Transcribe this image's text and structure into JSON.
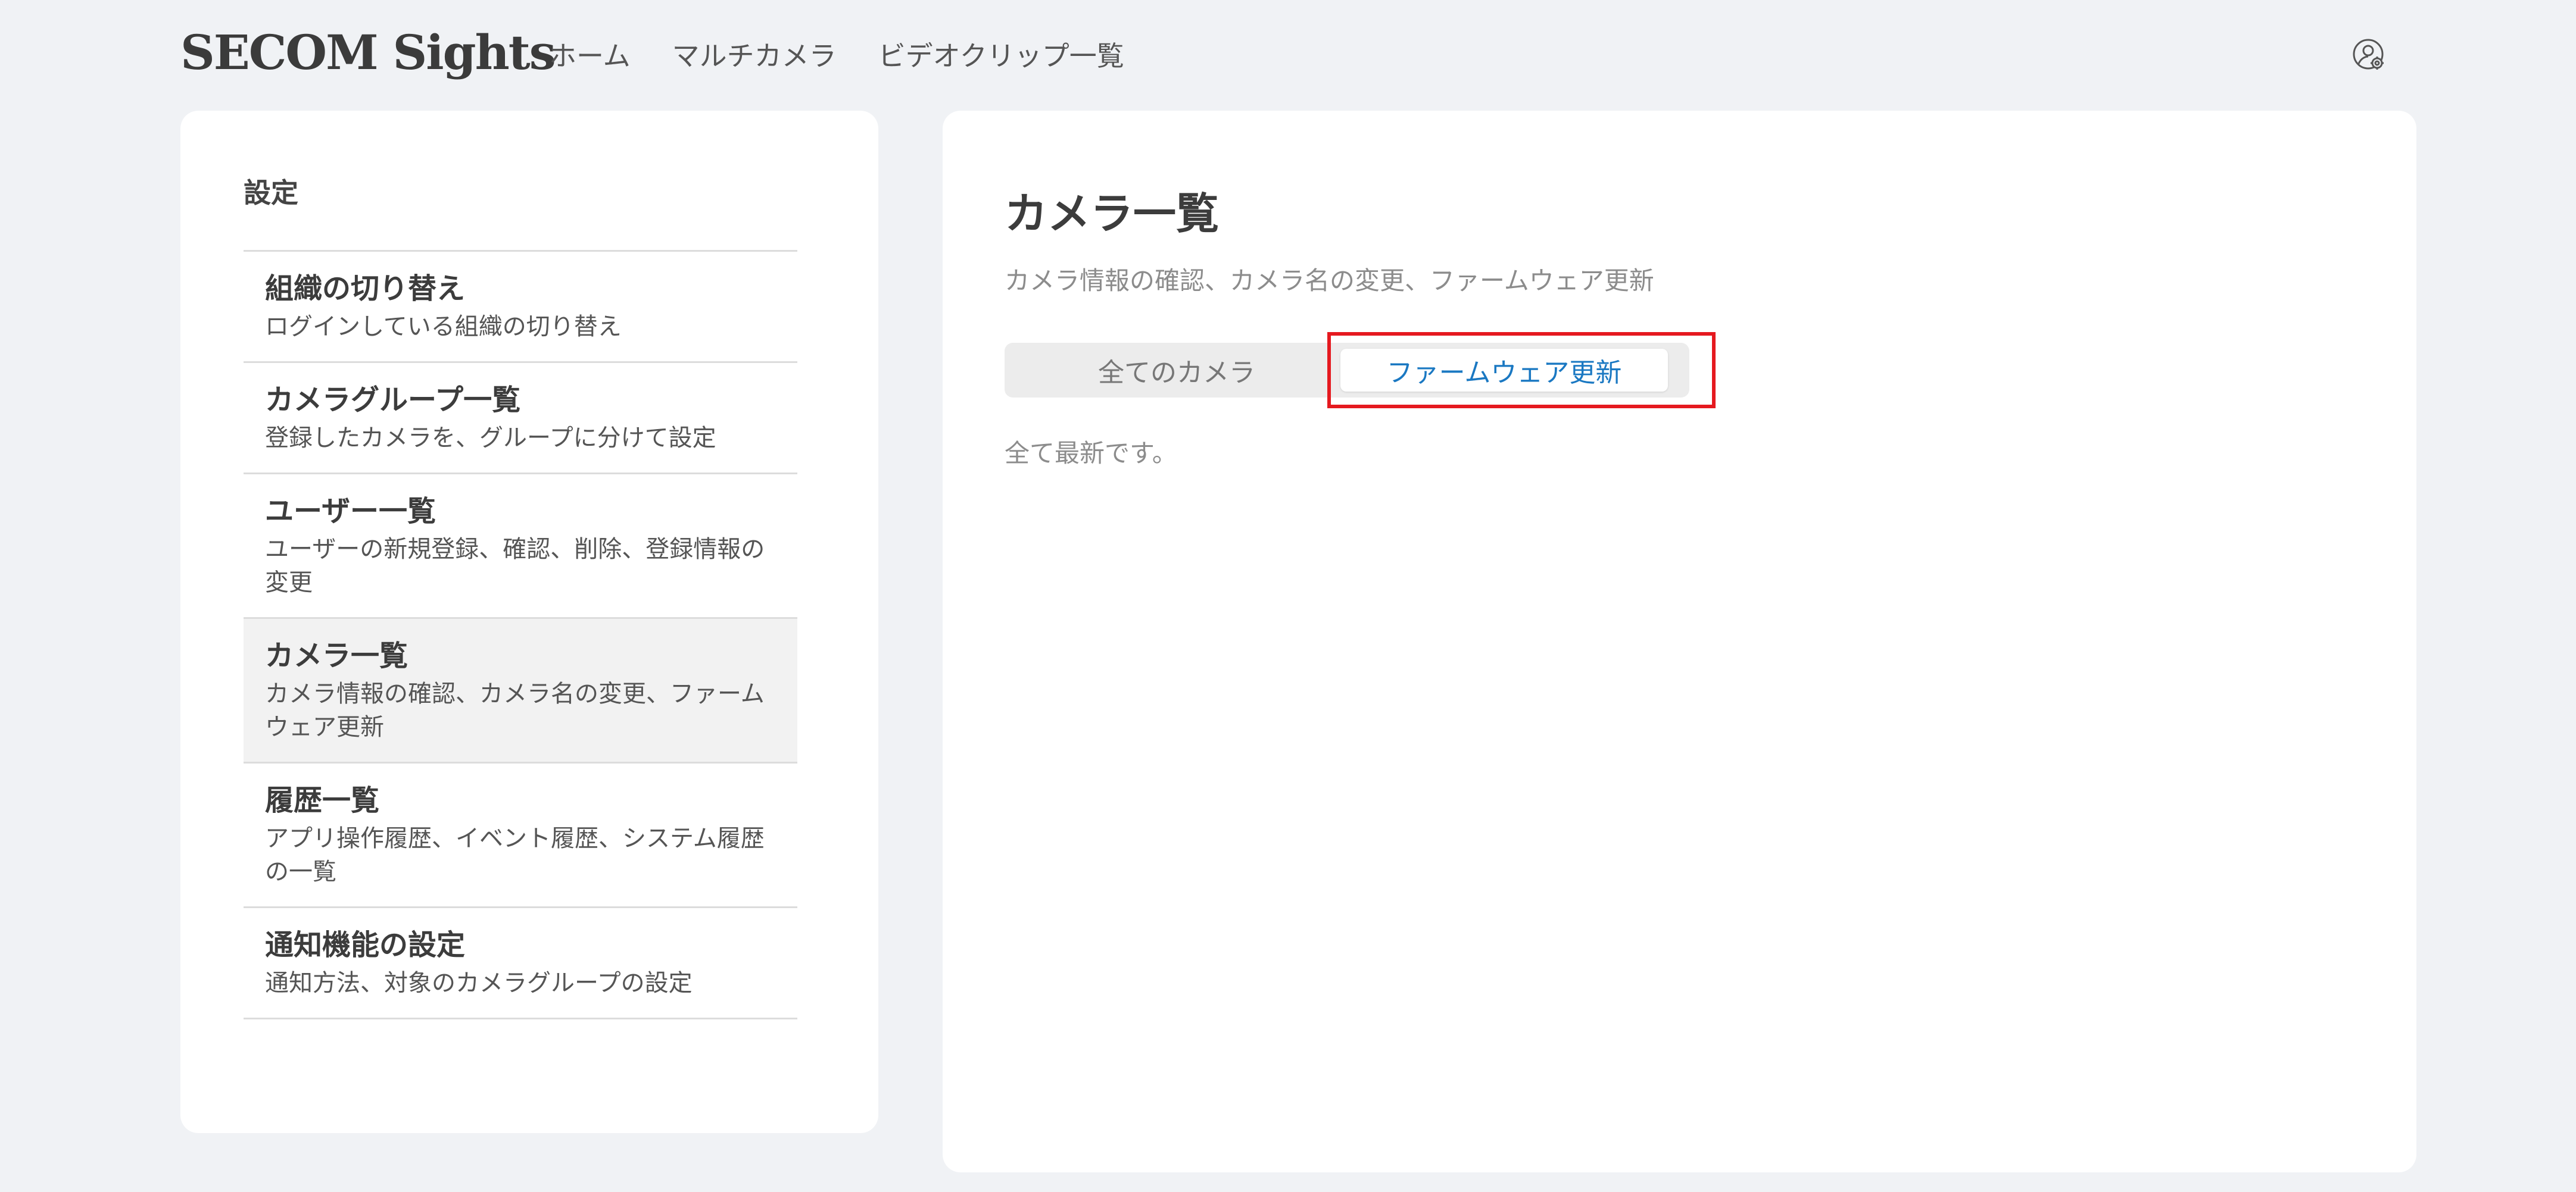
{
  "header": {
    "logo": "SECOM Sights",
    "nav": [
      {
        "label": "ホーム"
      },
      {
        "label": "マルチカメラ"
      },
      {
        "label": "ビデオクリップ一覧"
      }
    ],
    "account_icon": "account-settings-icon"
  },
  "sidebar": {
    "title": "設定",
    "items": [
      {
        "title": "組織の切り替え",
        "description": "ログインしている組織の切り替え",
        "active": false
      },
      {
        "title": "カメラグループ一覧",
        "description": "登録したカメラを、グループに分けて設定",
        "active": false
      },
      {
        "title": "ユーザー一覧",
        "description": "ユーザーの新規登録、確認、削除、登録情報の変更",
        "active": false
      },
      {
        "title": "カメラ一覧",
        "description": "カメラ情報の確認、カメラ名の変更、ファームウェア更新",
        "active": true
      },
      {
        "title": "履歴一覧",
        "description": "アプリ操作履歴、イベント履歴、システム履歴の一覧",
        "active": false
      },
      {
        "title": "通知機能の設定",
        "description": "通知方法、対象のカメラグループの設定",
        "active": false
      }
    ]
  },
  "main": {
    "title": "カメラ一覧",
    "description": "カメラ情報の確認、カメラ名の変更、ファームウェア更新",
    "tabs": [
      {
        "label": "全てのカメラ",
        "selected": false
      },
      {
        "label": "ファームウェア更新",
        "selected": true
      }
    ],
    "status": "全て最新です。"
  },
  "colors": {
    "background": "#f0f2f5",
    "accent": "#1a78c2",
    "highlight": "#e5191f"
  }
}
